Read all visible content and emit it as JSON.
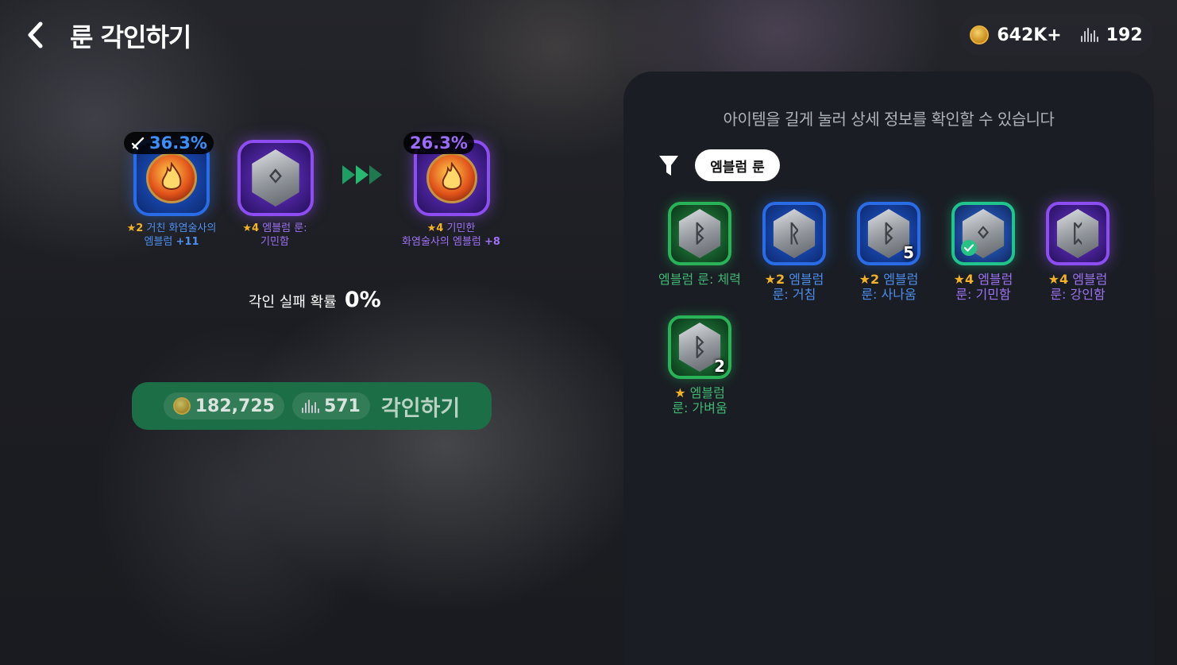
{
  "header": {
    "title": "룬 각인하기",
    "back_icon": "chevron-left-icon"
  },
  "currency": {
    "gold": "642K+",
    "shards": "192"
  },
  "engrave": {
    "target": {
      "chance": "36.3%",
      "star": "★2",
      "name_line1": "거친 화염술사의",
      "name_line2": "엠블럼",
      "level": "+11",
      "icon": "sword-icon"
    },
    "material": {
      "star": "★4",
      "name_line1": "엠블럼 룬:",
      "name_line2": "기민함"
    },
    "result": {
      "chance": "26.3%",
      "star": "★4",
      "name_line1": "기민한",
      "name_line2": "화염술사의 엠블럼",
      "level": "+8"
    },
    "fail_label": "각인 실패 확률",
    "fail_value": "0%",
    "button": {
      "gold_cost": "182,725",
      "shard_cost": "571",
      "label": "각인하기"
    }
  },
  "panel": {
    "hint": "아이템을 길게 눌러 상세 정보를 확인할 수 있습니다",
    "filter_label": "엠블럼 룬",
    "items": [
      {
        "glyph": "ᛒ",
        "count": "",
        "star": "",
        "line1": "엠블럼 룬: 체력",
        "line2": "",
        "selected": false
      },
      {
        "glyph": "ᚱ",
        "count": "",
        "star": "★2",
        "line1": "엠블럼",
        "line2": "룬: 거침",
        "selected": false
      },
      {
        "glyph": "ᛒ",
        "count": "5",
        "star": "★2",
        "line1": "엠블럼",
        "line2": "룬: 사나움",
        "selected": false
      },
      {
        "glyph": "ᛜ",
        "count": "",
        "star": "★4",
        "line1": "엠블럼",
        "line2": "룬: 기민함",
        "selected": true
      },
      {
        "glyph": "ᛈ",
        "count": "",
        "star": "★4",
        "line1": "엠블럼",
        "line2": "룬: 강인함",
        "selected": false
      },
      {
        "glyph": "ᛒ",
        "count": "2",
        "star": "★",
        "line1": "엠블럼",
        "line2": "룬: 가벼움",
        "selected": false
      }
    ]
  },
  "colors": {
    "accent_green": "#1b6e45",
    "rarity_blue": "#2a6be6",
    "rarity_purple": "#8d4df0",
    "rarity_green": "#29b257",
    "star_gold": "#f2b22b"
  }
}
